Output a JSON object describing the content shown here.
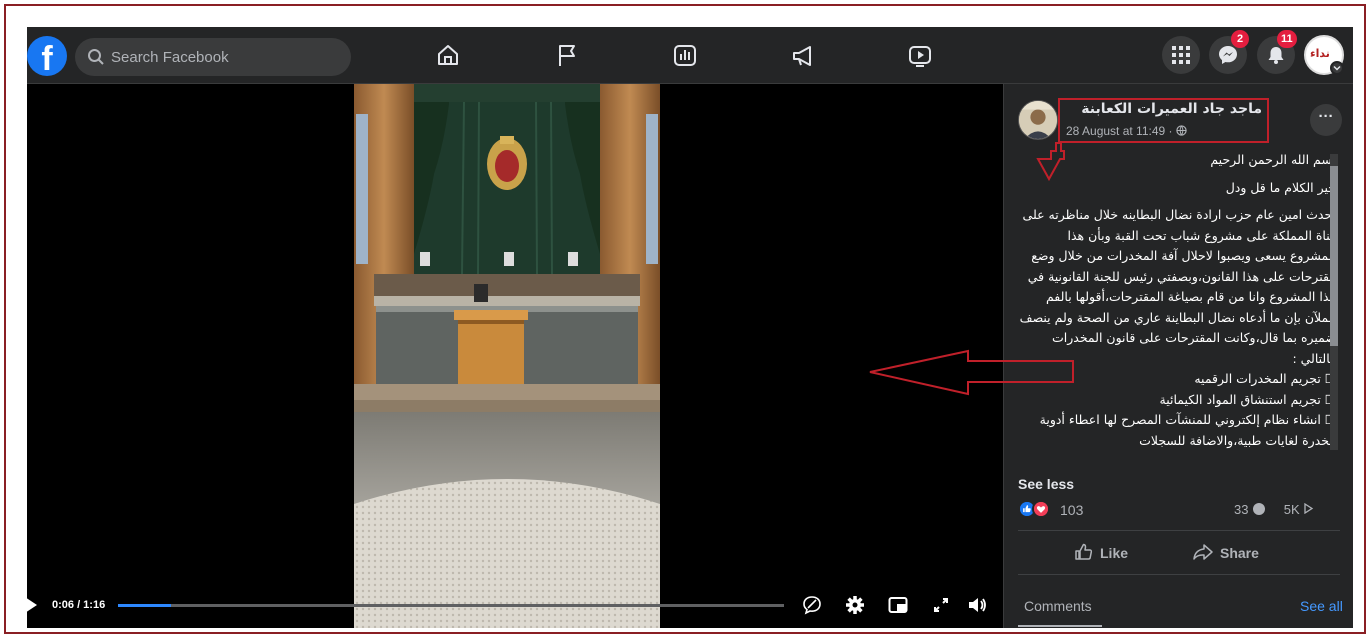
{
  "topbar": {
    "logo": "f",
    "search_placeholder": "Search Facebook",
    "nav_icons": [
      "home-icon",
      "pages-flag-icon",
      "dashboard-icon",
      "ads-megaphone-icon",
      "watch-icon"
    ],
    "messenger_badge": "2",
    "notifications_badge": "11",
    "avatar_text": "نداء"
  },
  "video": {
    "time": "0:06 / 1:16",
    "progress_fraction": 0.0789
  },
  "post": {
    "author": "ماجد جاد العميرات الكعابنة",
    "timestamp": "28 August at 11:49 · ",
    "paragraphs": [
      "بسم الله الرحمن الرحيم",
      "خير الكلام ما قل ودل",
      "تحدث امين عام حزب ارادة نضال البطاينه خلال مناظرته على قناة المملكة على مشروع شباب تحت القبة وبأن هذا المشروع يسعى ويصبوا لاحلال آفة المخدرات من خلال وضع مقترحات على هذا القانون،وبصفتي رئيس للجنة القانونية في هذا المشروع وانا من قام بصياغة المقترحات،أقولها بالفم الملآن بإن ما أدعاه نضال البطاينة عاري من الصحة ولم ينصف ضميره بما قال،وكانت المقترحات على قانون المخدرات كالتالي :"
    ],
    "items": [
      "☐ تجريم المخدرات الرقميه",
      "☐ تجريم استنشاق المواد الكيمائية",
      "☐ انشاء نظام إلكتروني للمنشآت المصرح لها اعطاء أدوية مخدرة لغايات طبية،والاضافة للسجلات"
    ],
    "see_less": "See less",
    "reaction_count": "103",
    "comments_count": "33",
    "shares_count": "5K",
    "like_label": "Like",
    "share_label": "Share",
    "comments_tab": "Comments",
    "see_all": "See all"
  },
  "colors": {
    "accent": "#2d88ff",
    "annotation": "#c0202a",
    "background": "#242526"
  }
}
